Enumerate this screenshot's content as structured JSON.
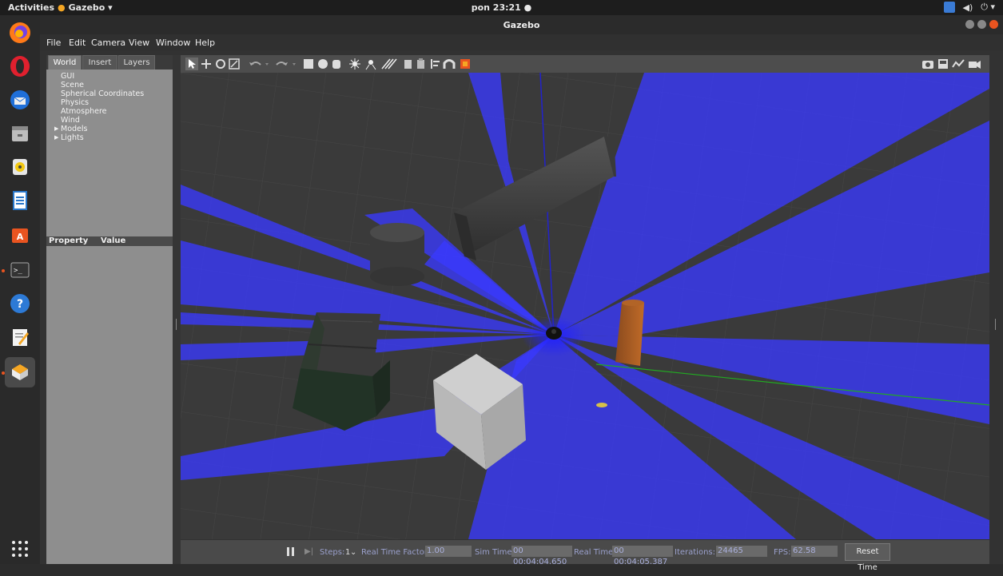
{
  "system": {
    "activities": "Activities",
    "app_menu": "Gazebo ▾",
    "clock": "pon 23:21 ●",
    "tray_volume": "◀)",
    "tray_power": "⏻ ▾"
  },
  "window": {
    "title": "Gazebo"
  },
  "menubar": {
    "items": [
      "File",
      "Edit",
      "Camera",
      "View",
      "Window",
      "Help"
    ]
  },
  "left_panel": {
    "tabs": [
      "World",
      "Insert",
      "Layers"
    ],
    "selected_tab": "World",
    "tree": [
      "GUI",
      "Scene",
      "Spherical Coordinates",
      "Physics",
      "Atmosphere",
      "Wind",
      "Models",
      "Lights"
    ],
    "property_header": "Property",
    "value_header": "Value"
  },
  "dock": {
    "apps": [
      "firefox-icon",
      "opera-icon",
      "thunderbird-icon",
      "files-icon",
      "rhythmbox-icon",
      "libreoffice-writer-icon",
      "software-center-icon",
      "terminal-icon",
      "help-icon",
      "text-editor-icon",
      "gazebo-icon"
    ]
  },
  "colors": {
    "laser": "#3a3aff",
    "ground": "#3a3a3a",
    "accent": "#e95420"
  },
  "bottom_bar": {
    "steps_label": "Steps:",
    "steps_value": "1",
    "rtf_label": "Real Time Factor:",
    "rtf_value": "1.00",
    "sim_time_label": "Sim Time:",
    "sim_time_value": "00 00:04:04.650",
    "real_time_label": "Real Time:",
    "real_time_value": "00 00:04:05.387",
    "iterations_label": "Iterations:",
    "iterations_value": "24465",
    "fps_label": "FPS:",
    "fps_value": "62.58",
    "reset_label": "Reset Time"
  }
}
